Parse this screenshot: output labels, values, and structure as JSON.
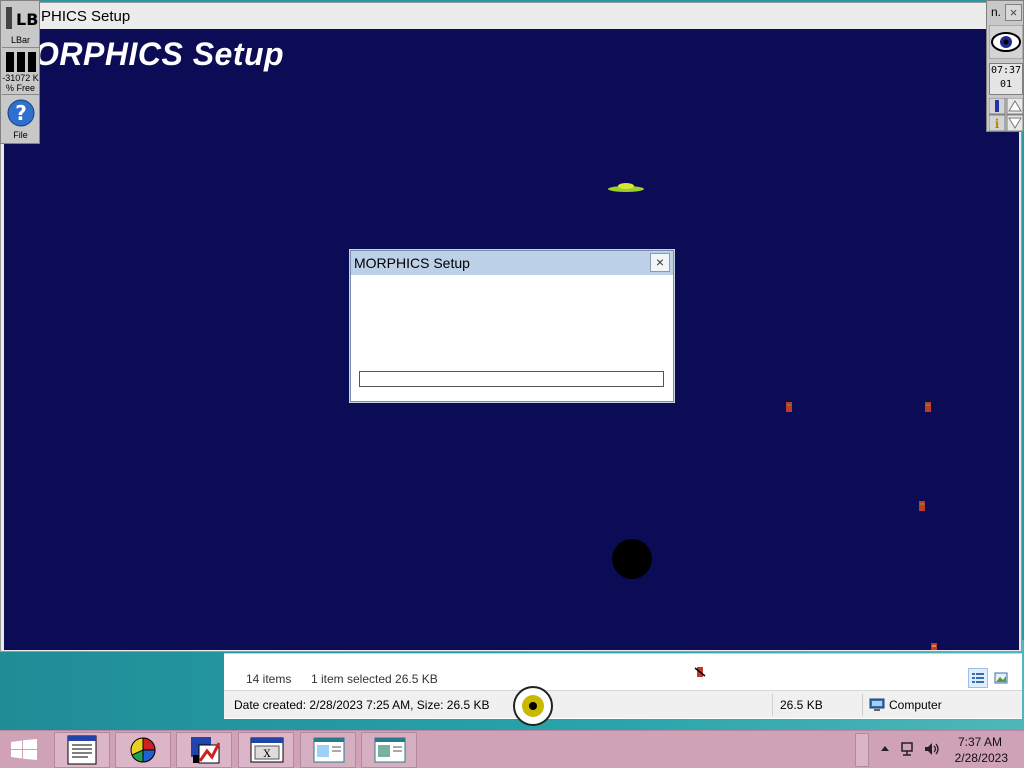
{
  "setup_window": {
    "title": "MORPHICS Setup",
    "title_visible": "PHICS Setup",
    "close_glyph": "×",
    "heading": "MORPHICS Setup",
    "heading_visible": "ORPHICS Setup",
    "background_color": "#0b0b56"
  },
  "dialog": {
    "title": "MORPHICS Setup",
    "close_glyph": "×",
    "progress_fraction": 0
  },
  "lbar": {
    "logo": "LB",
    "app_label": "LBar",
    "memory_value": "-31072 K",
    "memory_label": "% Free",
    "file_icon": "question-mark-icon",
    "file_label": "File"
  },
  "rbar": {
    "n_label": "n.",
    "close_glyph": "×",
    "clock_time": "07:37",
    "clock_sub": "01"
  },
  "explorer_status": {
    "items": "14 items",
    "selected": "1 item selected  26.5 KB",
    "details": "Date created: 2/28/2023 7:25 AM, Size: 26.5 KB",
    "size": "26.5 KB",
    "location": "Computer"
  },
  "taskbar": {
    "start_icon": "windows-logo-icon",
    "buttons": [
      "document-icon",
      "pie-chart-icon",
      "chart-app-icon",
      "window-app-icon",
      "notepad-window-icon",
      "explorer-window-icon"
    ],
    "ghost_close": "×",
    "time": "7:37 AM",
    "date": "2/28/2023"
  }
}
